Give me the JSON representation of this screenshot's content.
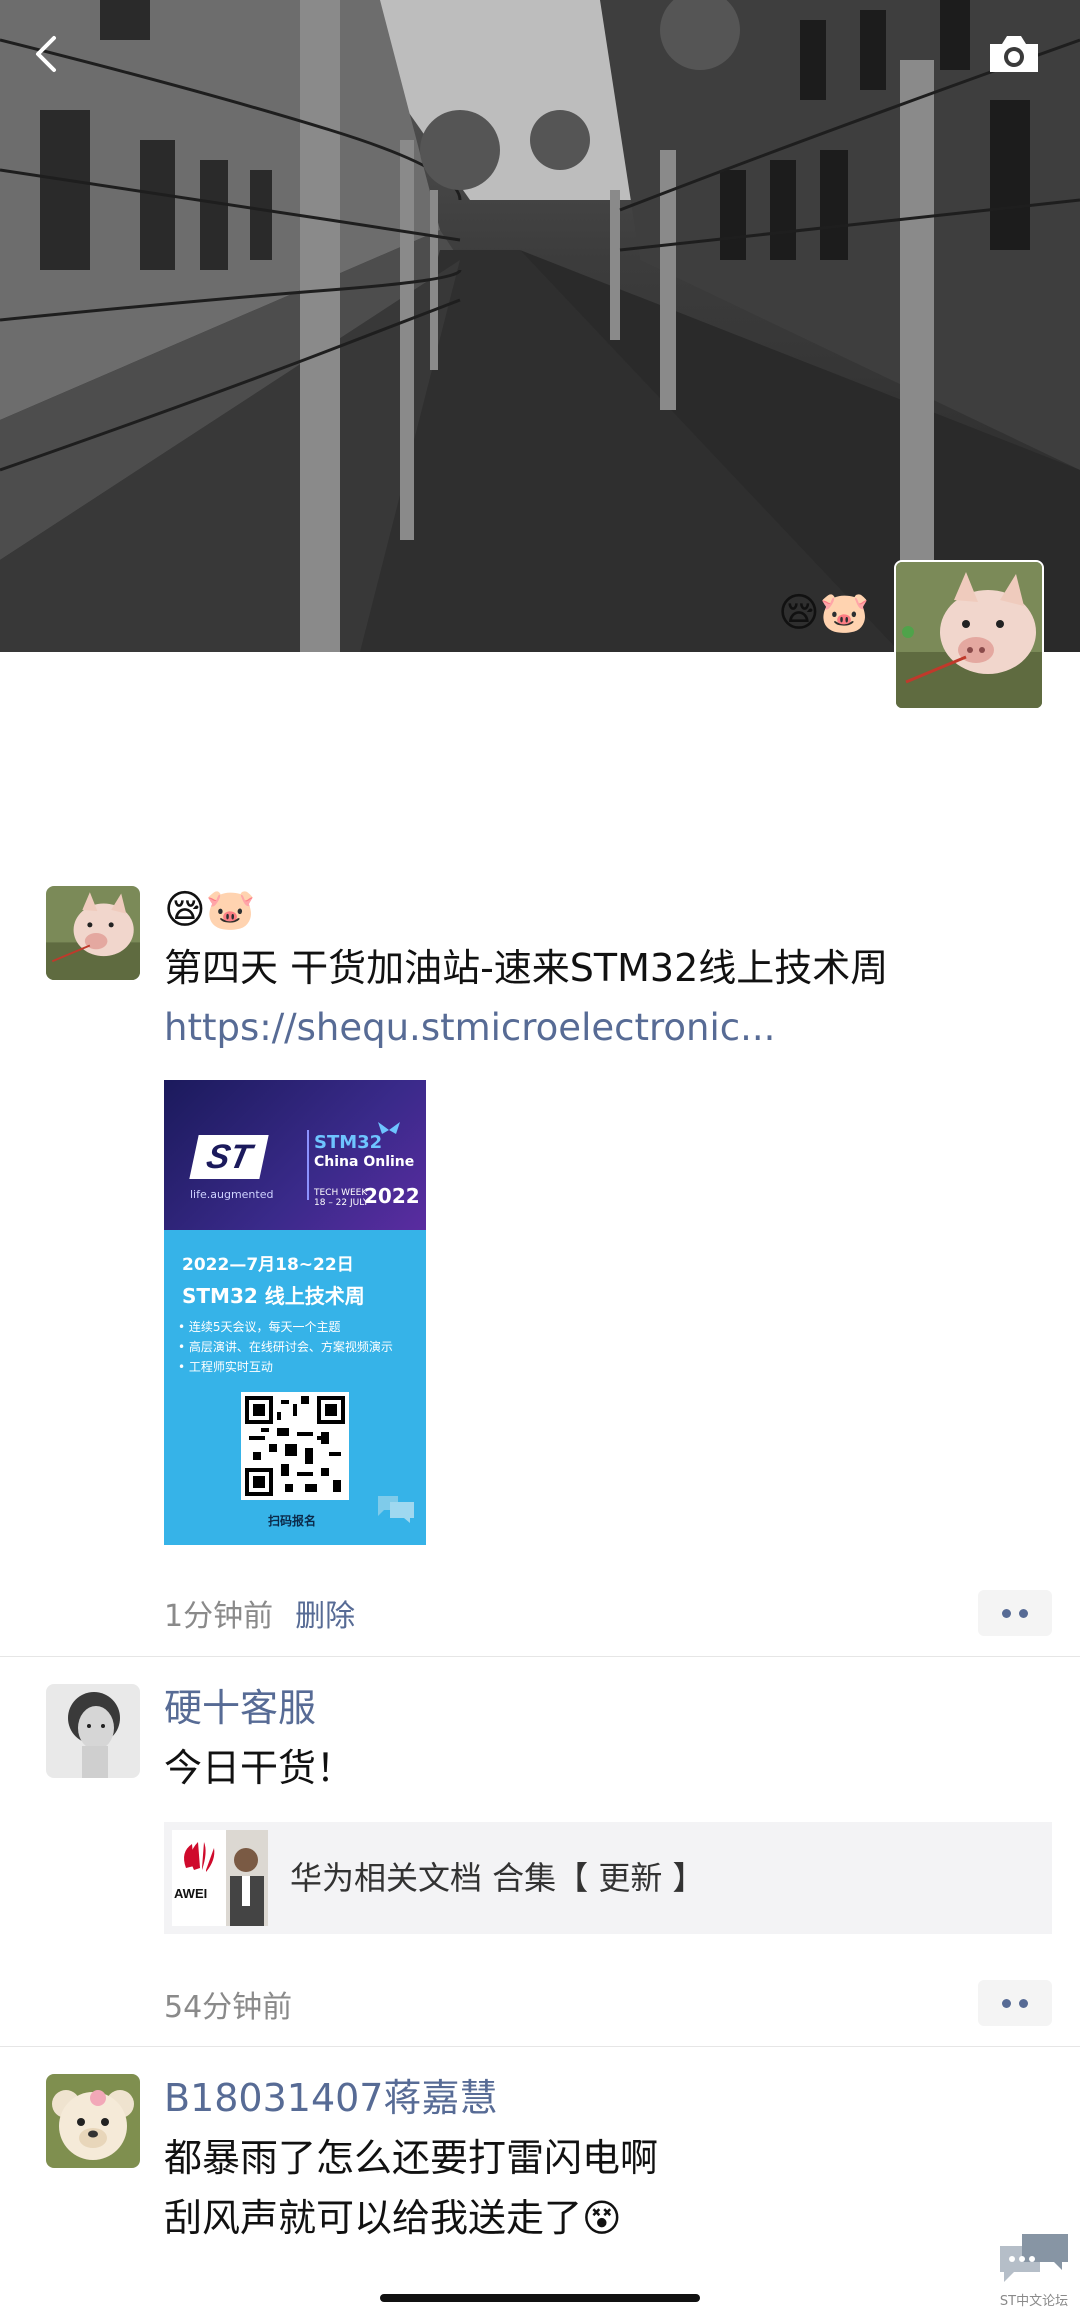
{
  "cover": {
    "owner_emoji": "😪🐷"
  },
  "posts": [
    {
      "emoji_line": "😪🐷",
      "text": "第四天  干货加油站-速来STM32线上技术周",
      "link": "https://shequ.stmicroelectronic",
      "link_ellipsis": "...",
      "poster": {
        "logo": "ST",
        "tagline": "life.augmented",
        "stm": "STM32",
        "china_online": "China Online",
        "tech_week": "TECH WEEK",
        "dates": "18 – 22 JULY",
        "year": "2022",
        "date_line": "2022—7月18~22日",
        "title": "STM32 线上技术周",
        "bullets": [
          "• 连续5天会议，每天一个主题",
          "• 高层演讲、在线研讨会、方案视频演示",
          "• 工程师实时互动"
        ],
        "qr_label": "扫码报名",
        "watermark": "ST中文论坛"
      },
      "time": "1分钟前",
      "delete": "删除"
    },
    {
      "nickname": "硬十客服",
      "text": "今日干货！",
      "link_card": {
        "title": "华为相关文档 合集【 更新 】",
        "thumb_brand": "AWEI"
      },
      "time": "54分钟前"
    },
    {
      "nickname": "B18031407蒋嘉慧",
      "text_line1": "都暴雨了怎么还要打雷闪电啊",
      "text_line2": "刮风声就可以给我送走了😵"
    }
  ],
  "watermark": "ST中文论坛",
  "colors": {
    "link_blue": "#576b95",
    "time_gray": "#8a8a8a",
    "poster_blue": "#36b3e8",
    "poster_purple": "#2a2470"
  }
}
